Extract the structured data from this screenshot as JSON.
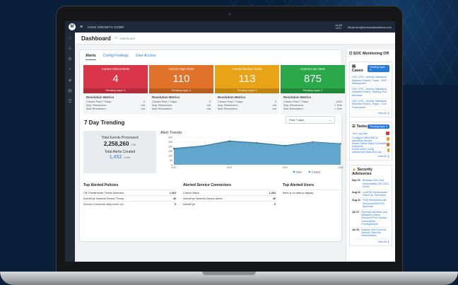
{
  "app": {
    "org": "HIGH GROWTH CORP",
    "time_line1": "14:53",
    "time_line2": "UTC",
    "user": "bill.jensen@motorolasolutions.com"
  },
  "icons": [
    "menu-icon",
    "home-icon",
    "search-icon",
    "settings-icon",
    "alert-icon",
    "chevron-down-icon",
    "warning-icon",
    "clipboard-icon",
    "tasks-icon",
    "shield-icon"
  ],
  "page": {
    "title": "Dashboard",
    "breadcrumb": "Dashboard"
  },
  "tabs": [
    "Alerts",
    "Config Findings",
    "User Access"
  ],
  "alerts": [
    {
      "title": "Current Critical Alerts",
      "value": "4",
      "pending": "Pending Input: 0",
      "color": "#d9364a",
      "res_title": "Resolution Metrics",
      "rows": [
        [
          "Closed Past 7 Days:",
          "0"
        ],
        [
          "Avg. Resolution:",
          "n/a"
        ],
        [
          "Max Resolution:",
          "n/a"
        ]
      ]
    },
    {
      "title": "Current High Alerts",
      "value": "110",
      "pending": "Pending Input: 0",
      "color": "#e0722a",
      "res_title": "Resolution Metrics",
      "rows": [
        [
          "Closed Past 7 Days:",
          "0"
        ],
        [
          "Avg. Resolution:",
          "n/a"
        ],
        [
          "Max Resolution:",
          "n/a"
        ]
      ]
    },
    {
      "title": "Current Medium Alerts",
      "value": "113",
      "pending": "Pending Input: 0",
      "color": "#e8a317",
      "res_title": "Resolution Metrics",
      "rows": [
        [
          "Closed Past 7 Days:",
          "0"
        ],
        [
          "Avg. Resolution:",
          "n/a"
        ],
        [
          "Max Resolution:",
          "n/a"
        ]
      ]
    },
    {
      "title": "Current Low Alerts",
      "value": "875",
      "pending": "Pending Input: 0",
      "color": "#2aa84a",
      "res_title": "Resolution Metrics",
      "rows": [
        [
          "Closed Past 7 Days:",
          "1402"
        ],
        [
          "Avg. Resolution:",
          "< 10m"
        ],
        [
          "Max Resolution:",
          "< 10m"
        ]
      ]
    }
  ],
  "trending": {
    "title": "7 Day Trending",
    "range": "Past 7 days",
    "events_label": "Total Events Processed",
    "events_value": "2,258,260",
    "events_change": "↓7%",
    "alerts_label": "Total Alerts Created",
    "alerts_value": "1,452",
    "alerts_change": "↓14%"
  },
  "chart_data": {
    "type": "area",
    "title": "Alert Trends",
    "x": [
      "9/20",
      "9/21",
      "9/22",
      "9/23",
      "9/24",
      "9/25",
      "9/26"
    ],
    "series": [
      {
        "name": "New",
        "values": [
          180,
          205,
          260,
          240,
          210,
          250,
          230
        ]
      },
      {
        "name": "Closed",
        "values": [
          170,
          200,
          255,
          235,
          205,
          248,
          228
        ]
      }
    ],
    "ylim": [
      0,
      300
    ],
    "yticks": [
      "300",
      "250",
      "200",
      "150",
      "100",
      "50",
      "0"
    ],
    "xticks": [
      "9/20",
      "9/22",
      "9/24",
      "9/26"
    ],
    "legend_position": "bottom",
    "colors": [
      "#4f97c4",
      "#5aa7cf"
    ]
  },
  "tables": {
    "policies": {
      "title": "Top Alerted Policies",
      "rows": [
        [
          "CB ThreatHunter Threat Detected...",
          "1,463"
        ],
        [
          "ActiveEye Network Sensor Threat ...",
          "46"
        ],
        [
          "Service Connector daily event vol...",
          "5"
        ]
      ]
    },
    "connectors": {
      "title": "Alerted Service Connectors",
      "rows": [
        [
          "Carbon Black",
          "1,463"
        ],
        [
          "ActiveEye Network Sensor Alerts",
          "46"
        ],
        [
          "ActiveEye",
          "5"
        ]
      ]
    },
    "users": {
      "title": "Top Alerted Users",
      "empty": "there is no data to display."
    }
  },
  "right": {
    "soc": "SOC Monitoring Off",
    "cases_title": "Cases",
    "cases_pill": "Pending Input: 3",
    "cases": [
      "HGC (PS) - Activity Validation| Malware Exited | Trojan - RAT - Metasploiter",
      "HGC (PS) - Activity Validation| Malware Exited | Hacking Tool - Mimikatz",
      "HGC (PS) - Activity Validation| Malware Exited | Trojan - Tool - Powersploit"
    ],
    "cases_viewall": "View All ❯",
    "tasks_title": "Tasks",
    "tasks_pill": "Pending Input: 3",
    "tasks": [
      {
        "label": "Test Log Task",
        "color": "#d9364a"
      },
      {
        "label": "Configure Office365 for ActiveEye access",
        "color": "#e8a317"
      },
      {
        "label": "Install Carbon Black to finance endpoints",
        "color": "#e0722a"
      },
      {
        "label": "Export entire config assessment data at to csv",
        "color": "#e8a317"
      }
    ],
    "tasks_viewall": "View All ❯",
    "adv_title": "Security Advisories",
    "advisories": [
      [
        "Sep 20",
        "Windows Zero-Day Vulnerability(CVE-2021-40444"
      ],
      [
        "Aug 31",
        "LockFile Ransomware New Ever Technique"
      ],
      [
        "Aug 31",
        "FIN8 Resurfaces with Sardonic(BHATCH) Backdoor"
      ],
      [
        "Jul 07",
        "Recently Identified and Mitigated Critical Microsoft Print Spooler Vulnerability - PrintNightmare"
      ],
      [
        "Jul 03",
        "Kaseya VSA Products Actively Tailed By Ransomware"
      ]
    ],
    "adv_viewall": "View All ❯"
  }
}
